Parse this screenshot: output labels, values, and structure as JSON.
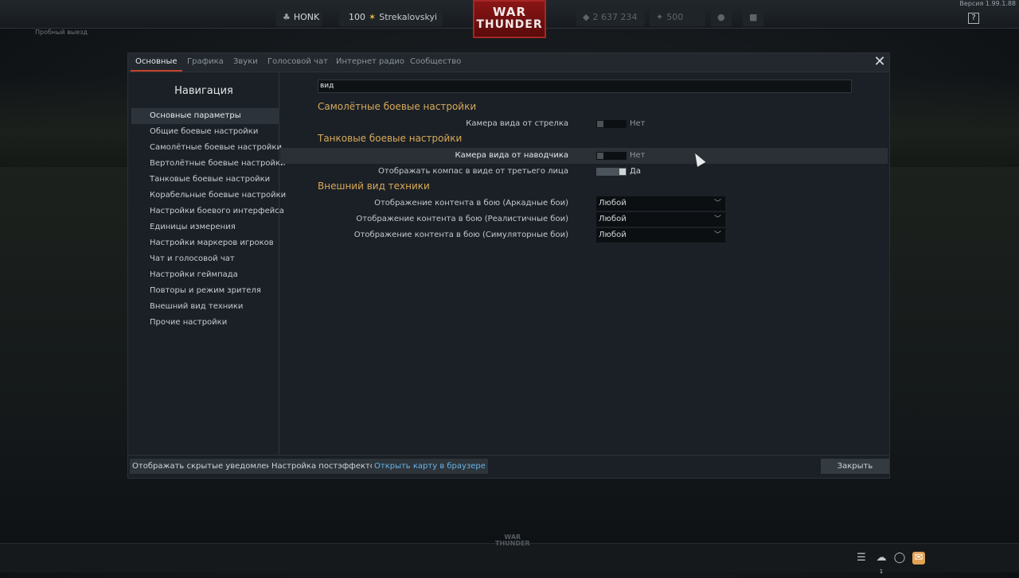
{
  "top": {
    "version": "Версия 1.99.1.88",
    "help": "?",
    "squad_tag": "HONK",
    "level": "100",
    "username": "Strekalovskyi",
    "silver_lions": "2 637 234",
    "golden_eagles": "500",
    "logo_line1": "WAR",
    "logo_line2": "THUNDER",
    "subtitle": "Пробный выезд"
  },
  "tabs": [
    "Основные",
    "Графика",
    "Звуки",
    "Голосовой чат",
    "Интернет радио",
    "Сообщество"
  ],
  "navigation": {
    "title": "Навигация",
    "items": [
      "Основные параметры",
      "Общие боевые настройки",
      "Самолётные боевые настройки",
      "Вертолётные боевые настройки",
      "Танковые боевые настройки",
      "Корабельные боевые настройки",
      "Настройки боевого интерфейса",
      "Единицы измерения",
      "Настройки маркеров игроков",
      "Чат и голосовой чат",
      "Настройки геймпада",
      "Повторы и режим зрителя",
      "Внешний вид техники",
      "Прочие настройки"
    ]
  },
  "search": {
    "value": "вид"
  },
  "sections": {
    "aircraft": {
      "title": "Самолётные боевые настройки",
      "gunner_camera_label": "Камера вида от стрелка",
      "gunner_camera_value": "Нет"
    },
    "tank": {
      "title": "Танковые боевые настройки",
      "gunner_sight_label": "Камера вида от наводчика",
      "gunner_sight_value": "Нет",
      "compass_label": "Отображать компас в виде от третьего лица",
      "compass_value": "Да"
    },
    "appearance": {
      "title": "Внешний вид техники",
      "arcade_label": "Отображение контента в бою (Аркадные бои)",
      "arcade_value": "Любой",
      "realistic_label": "Отображение контента в бою (Реалистичные бои)",
      "realistic_value": "Любой",
      "simulator_label": "Отображение контента в бою (Симуляторные бои)",
      "simulator_value": "Любой"
    }
  },
  "footer": {
    "hidden_notifications": "Отображать скрытые уведомления",
    "postfx": "Настройка постэффектов",
    "open_map": "Открыть карту в браузере",
    "close": "Закрыть"
  },
  "bottom": {
    "logo_line1": "WAR",
    "logo_line2": "THUNDER",
    "friends_count": "1"
  },
  "colors": {
    "section_title": "#d7a95b",
    "tab_accent": "#c2412d",
    "link": "#69b4e8",
    "mail": "#e2a255"
  },
  "icons": [
    "squad-icon",
    "rank-icon",
    "silver-lions-icon",
    "golden-eagles-icon",
    "premium-icon",
    "battlepass-icon",
    "list-icon",
    "friends-icon",
    "chat-icon",
    "mail-icon",
    "close-icon"
  ]
}
